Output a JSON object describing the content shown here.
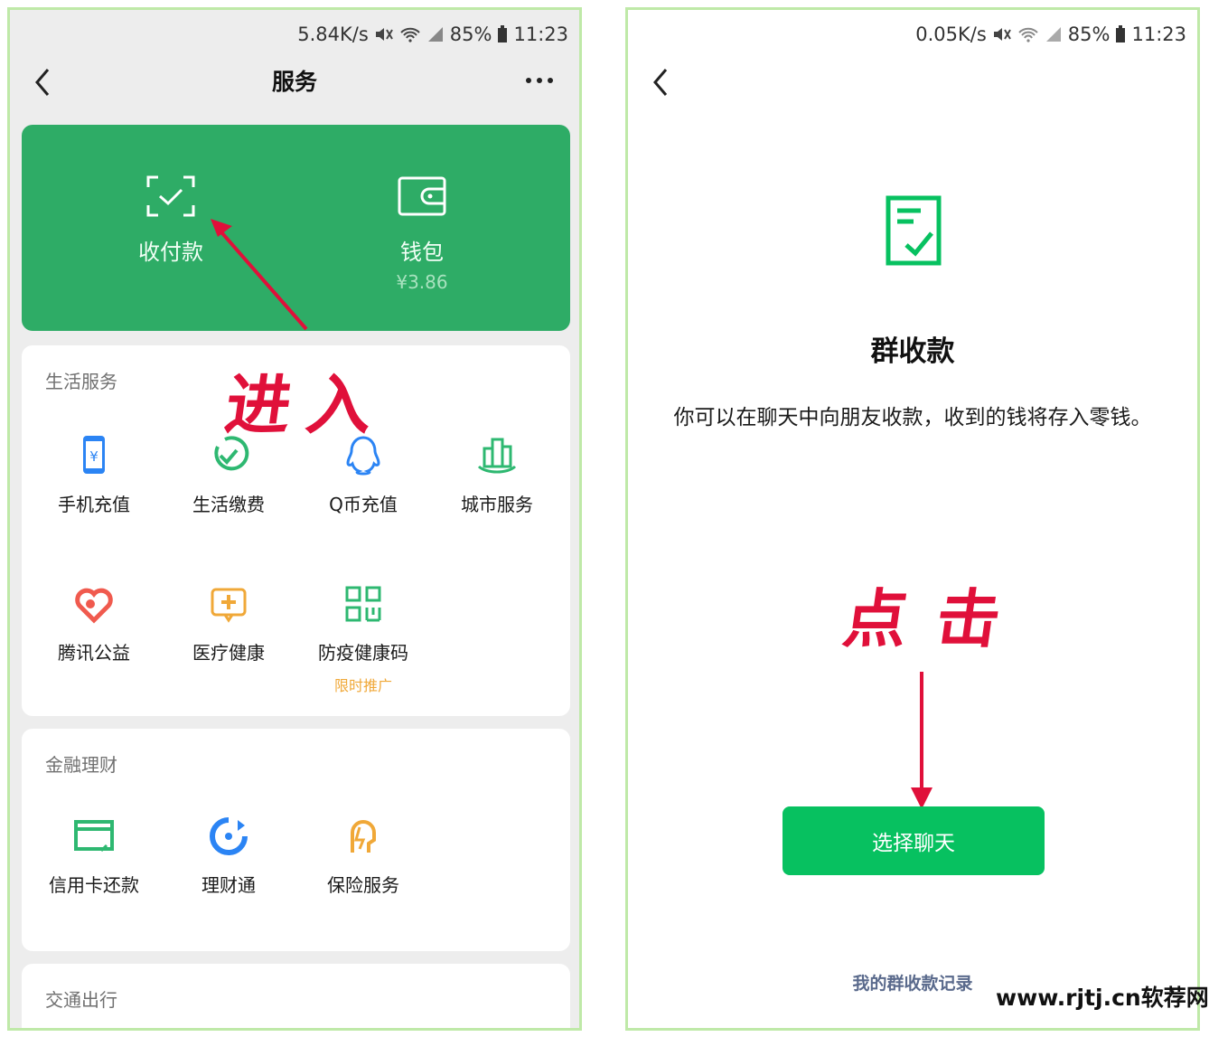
{
  "left": {
    "status": {
      "speed": "5.84K/s",
      "battery": "85%",
      "time": "11:23"
    },
    "nav": {
      "title": "服务"
    },
    "hero": {
      "pay": {
        "label": "收付款",
        "icon": "scan-check-icon"
      },
      "wallet": {
        "label": "钱包",
        "balance": "¥3.86",
        "icon": "wallet-icon"
      }
    },
    "life": {
      "title": "生活服务",
      "items": [
        {
          "label": "手机充值",
          "icon": "phone-topup-icon",
          "color": "#2b84f4"
        },
        {
          "label": "生活缴费",
          "icon": "utility-bill-icon",
          "color": "#2eb871"
        },
        {
          "label": "Q币充值",
          "icon": "qq-coin-icon",
          "color": "#2b84f4"
        },
        {
          "label": "城市服务",
          "icon": "city-service-icon",
          "color": "#2eb871"
        },
        {
          "label": "腾讯公益",
          "icon": "charity-heart-icon",
          "color": "#f05a4e"
        },
        {
          "label": "医疗健康",
          "icon": "medical-icon",
          "color": "#f0a838"
        },
        {
          "label": "防疫健康码",
          "sub": "限时推广",
          "icon": "health-code-icon",
          "color": "#2eb871"
        }
      ]
    },
    "finance": {
      "title": "金融理财",
      "items": [
        {
          "label": "信用卡还款",
          "icon": "credit-card-icon",
          "color": "#2eb871"
        },
        {
          "label": "理财通",
          "icon": "wealth-icon",
          "color": "#2b84f4"
        },
        {
          "label": "保险服务",
          "icon": "insurance-icon",
          "color": "#f0a838"
        }
      ]
    },
    "transport": {
      "title": "交通出行"
    },
    "annotation": "进入"
  },
  "right": {
    "status": {
      "speed": "0.05K/s",
      "battery": "85%",
      "time": "11:23"
    },
    "title": "群收款",
    "description": "你可以在聊天中向朋友收款，收到的钱将存入零钱。",
    "annotation": "点 击",
    "button": "选择聊天",
    "records_link": "我的群收款记录"
  },
  "watermark": "www.rjtj.cn软荐网",
  "colors": {
    "brand_green": "#07c160",
    "hero_green": "#2eac66",
    "annotation_red": "#e0103a"
  }
}
